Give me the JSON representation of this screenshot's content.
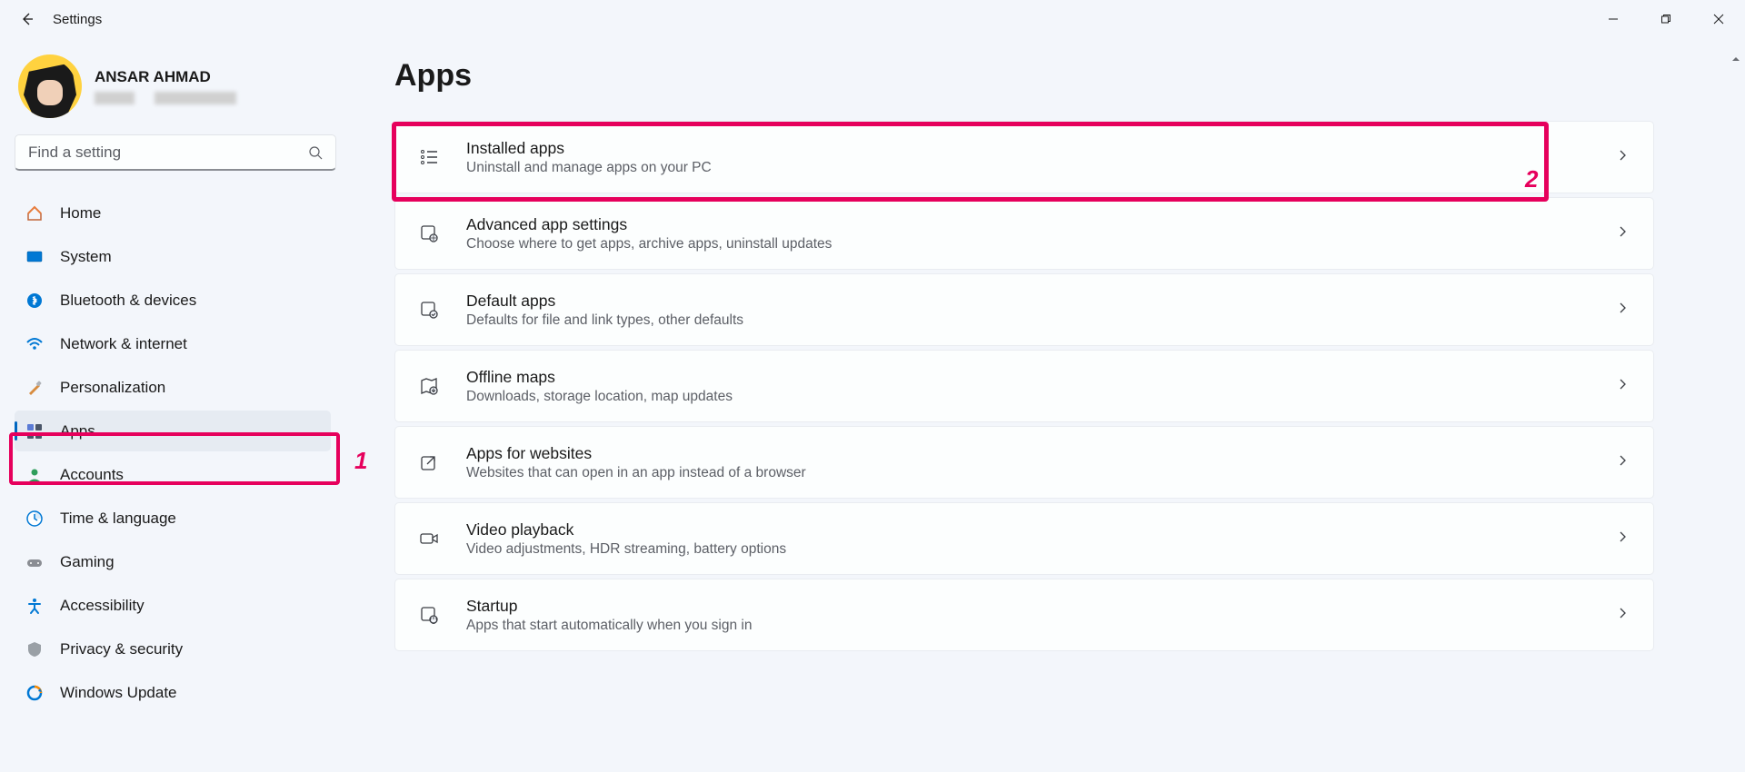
{
  "window": {
    "title": "Settings"
  },
  "profile": {
    "name": "ANSAR AHMAD"
  },
  "search": {
    "placeholder": "Find a setting"
  },
  "nav": {
    "home": "Home",
    "system": "System",
    "bluetooth": "Bluetooth & devices",
    "network": "Network & internet",
    "personalization": "Personalization",
    "apps": "Apps",
    "accounts": "Accounts",
    "time": "Time & language",
    "gaming": "Gaming",
    "accessibility": "Accessibility",
    "privacy": "Privacy & security",
    "update": "Windows Update"
  },
  "page": {
    "title": "Apps",
    "cards": {
      "installed": {
        "title": "Installed apps",
        "sub": "Uninstall and manage apps on your PC"
      },
      "advanced": {
        "title": "Advanced app settings",
        "sub": "Choose where to get apps, archive apps, uninstall updates"
      },
      "default": {
        "title": "Default apps",
        "sub": "Defaults for file and link types, other defaults"
      },
      "maps": {
        "title": "Offline maps",
        "sub": "Downloads, storage location, map updates"
      },
      "websites": {
        "title": "Apps for websites",
        "sub": "Websites that can open in an app instead of a browser"
      },
      "video": {
        "title": "Video playback",
        "sub": "Video adjustments, HDR streaming, battery options"
      },
      "startup": {
        "title": "Startup",
        "sub": "Apps that start automatically when you sign in"
      }
    }
  },
  "annotations": {
    "n1": "1",
    "n2": "2"
  }
}
